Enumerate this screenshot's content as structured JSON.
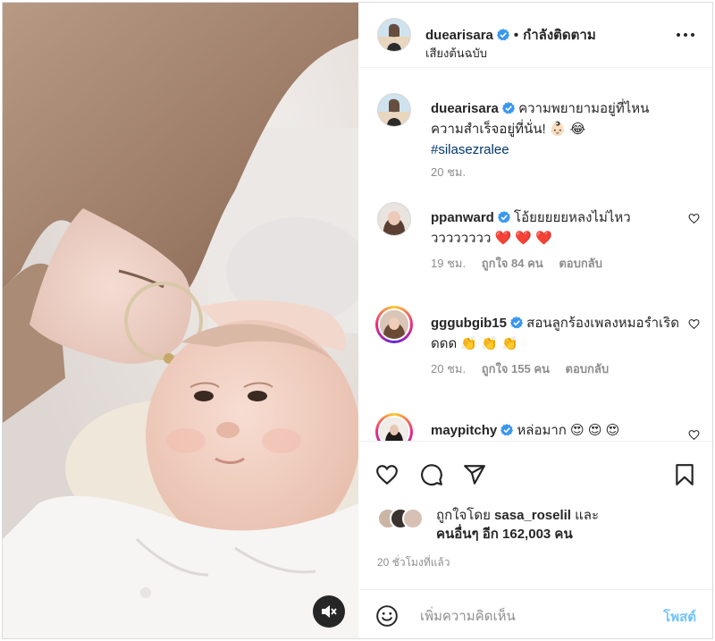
{
  "post": {
    "author": "duearisara",
    "follow_status": "กำลังติดตาม",
    "audio_label": "เสียงต้นฉบับ",
    "media": {
      "mute_icon": "speaker-muted-icon"
    }
  },
  "caption": {
    "username": "duearisara",
    "text": "ความพยายามอยู่ที่ไหน ความสำเร็จอยู่ที่นั่น! 👶🏻 😂",
    "hashtag": "#silasezralee",
    "time": "20 ชม."
  },
  "comments": [
    {
      "username": "ppanward",
      "text": "โอ้ยยยยยหลงไม่ไหววววววววว ❤️ ❤️ ❤️",
      "time": "19 ชม.",
      "likes": "ถูกใจ 84 คน",
      "reply": "ตอบกลับ"
    },
    {
      "username": "gggubgib15",
      "text": "สอนลูกร้องเพลงหมอรำเริดดดด 👏 👏 👏",
      "time": "20 ชม.",
      "likes": "ถูกใจ 155 คน",
      "reply": "ตอบกลับ"
    },
    {
      "username": "maypitchy",
      "text": "หล่อมาก 😍 😍 😍"
    }
  ],
  "actions": {
    "icons": [
      "heart-icon",
      "comment-icon",
      "share-icon",
      "bookmark-icon"
    ],
    "liked_by_prefix": "ถูกใจโดย",
    "liked_by_user": "sasa_roselil",
    "liked_by_and": "และ",
    "liked_by_others": "คนอื่นๆ อีก 162,003 คน",
    "time_ago": "20 ชั่วโมงที่แล้ว"
  },
  "comment_box": {
    "placeholder": "เพิ่มความคิดเห็น",
    "post_label": "โพสต์"
  },
  "colors": {
    "accent_blue": "#0095f6",
    "verified_blue": "#3897f0",
    "muted_text": "#8e8e8e",
    "hashtag": "#00376b",
    "heart_red": "#ed4956"
  }
}
